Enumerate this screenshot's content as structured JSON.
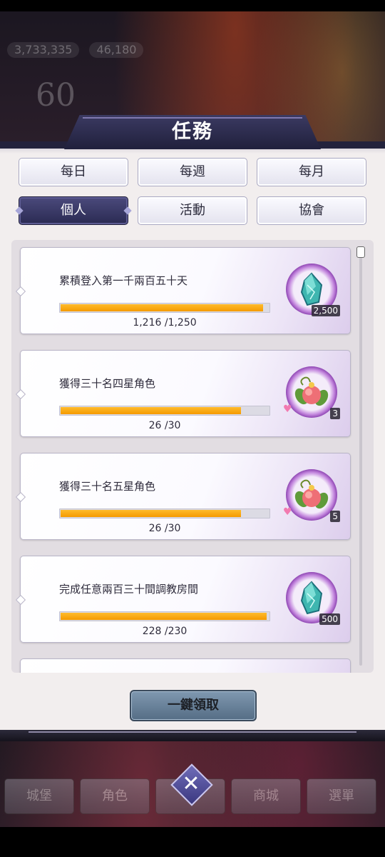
{
  "background": {
    "hud_values": [
      "3,733,335",
      "46,180"
    ],
    "level": "60"
  },
  "dialog": {
    "title": "任務",
    "tabs": [
      {
        "label": "每日",
        "active": false
      },
      {
        "label": "每週",
        "active": false
      },
      {
        "label": "每月",
        "active": false
      },
      {
        "label": "個人",
        "active": true
      },
      {
        "label": "活動",
        "active": false
      },
      {
        "label": "協會",
        "active": false
      }
    ],
    "missions": [
      {
        "title": "累積登入第一千兩百五十天",
        "current": 1216,
        "total": 1250,
        "progress_text": "1,216 /1,250",
        "reward_icon": "crystal-icon",
        "reward_qty": "2,500"
      },
      {
        "title": "獲得三十名四星角色",
        "current": 26,
        "total": 30,
        "progress_text": "26 /30",
        "reward_icon": "peach-icon",
        "reward_qty": "3"
      },
      {
        "title": "獲得三十名五星角色",
        "current": 26,
        "total": 30,
        "progress_text": "26 /30",
        "reward_icon": "peach-icon",
        "reward_qty": "5"
      },
      {
        "title": "完成任意兩百三十間調教房間",
        "current": 228,
        "total": 230,
        "progress_text": "228 /230",
        "reward_icon": "crystal-icon",
        "reward_qty": "500"
      }
    ],
    "claim_all_label": "一鍵領取"
  },
  "bottom_nav": {
    "items": [
      "城堡",
      "角色",
      "",
      "商城",
      "選單"
    ],
    "close_label": "✕"
  },
  "colors": {
    "accent": "#2a2a52",
    "progress": "#f5a300",
    "panel": "#f2eeee"
  }
}
